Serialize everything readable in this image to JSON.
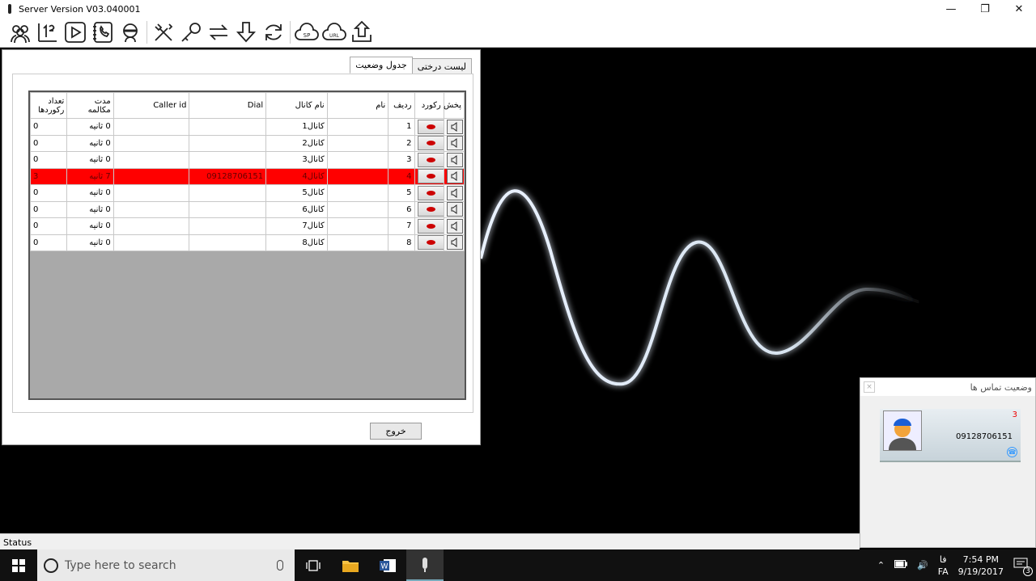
{
  "window": {
    "title": "Server Version V03.040001"
  },
  "toolbar": {
    "buttons": [
      {
        "name": "users-icon"
      },
      {
        "name": "numbers-icon"
      },
      {
        "name": "play-icon"
      },
      {
        "name": "phonebook-icon"
      },
      {
        "name": "operator-icon"
      },
      {
        "name": "tools-icon"
      },
      {
        "name": "key-icon"
      },
      {
        "name": "transfer-icon"
      },
      {
        "name": "download-icon"
      },
      {
        "name": "refresh-icon"
      },
      {
        "name": "sp-cloud-icon"
      },
      {
        "name": "url-cloud-icon"
      },
      {
        "name": "upload-icon"
      }
    ],
    "sp_label": "SP",
    "url_label": "URL"
  },
  "dialog": {
    "tabs": {
      "tree": "لیست درختی",
      "status": "جدول وضعیت"
    },
    "columns": {
      "play": "پخش",
      "record": "رکورد",
      "row": "ردیف",
      "name": "نام",
      "channel": "نام کانال",
      "dial": "Dial",
      "caller": "Caller id",
      "duration": "مدت مکالمه",
      "count": "تعداد رکوردها"
    },
    "rows": [
      {
        "row": "1",
        "name": "",
        "channel": "کانال1",
        "dial": "",
        "caller": "",
        "duration": "0 ثانیه",
        "count": "0"
      },
      {
        "row": "2",
        "name": "",
        "channel": "کانال2",
        "dial": "",
        "caller": "",
        "duration": "0 ثانیه",
        "count": "0"
      },
      {
        "row": "3",
        "name": "",
        "channel": "کانال3",
        "dial": "",
        "caller": "",
        "duration": "0 ثانیه",
        "count": "0"
      },
      {
        "row": "4",
        "name": "",
        "channel": "کانال4",
        "dial": "09128706151",
        "caller": "",
        "duration": "7 ثانیه",
        "count": "3"
      },
      {
        "row": "5",
        "name": "",
        "channel": "کانال5",
        "dial": "",
        "caller": "",
        "duration": "0 ثانیه",
        "count": "0"
      },
      {
        "row": "6",
        "name": "",
        "channel": "کانال6",
        "dial": "",
        "caller": "",
        "duration": "0 ثانیه",
        "count": "0"
      },
      {
        "row": "7",
        "name": "",
        "channel": "کانال7",
        "dial": "",
        "caller": "",
        "duration": "0 ثانیه",
        "count": "0"
      },
      {
        "row": "8",
        "name": "",
        "channel": "کانال8",
        "dial": "",
        "caller": "",
        "duration": "0 ثانیه",
        "count": "0"
      }
    ],
    "exit_label": "خروج",
    "highlight_color": "#ff0000"
  },
  "side_panel": {
    "title": "وضعیت تماس ها",
    "close": "×",
    "count": "3",
    "number": "09128706151"
  },
  "statusbar": {
    "text": "Status"
  },
  "taskbar": {
    "search_placeholder": "Type here to search",
    "lang_fa": "فا",
    "lang": "FA",
    "time": "7:54 PM",
    "date": "9/19/2017",
    "notifications": "3"
  }
}
